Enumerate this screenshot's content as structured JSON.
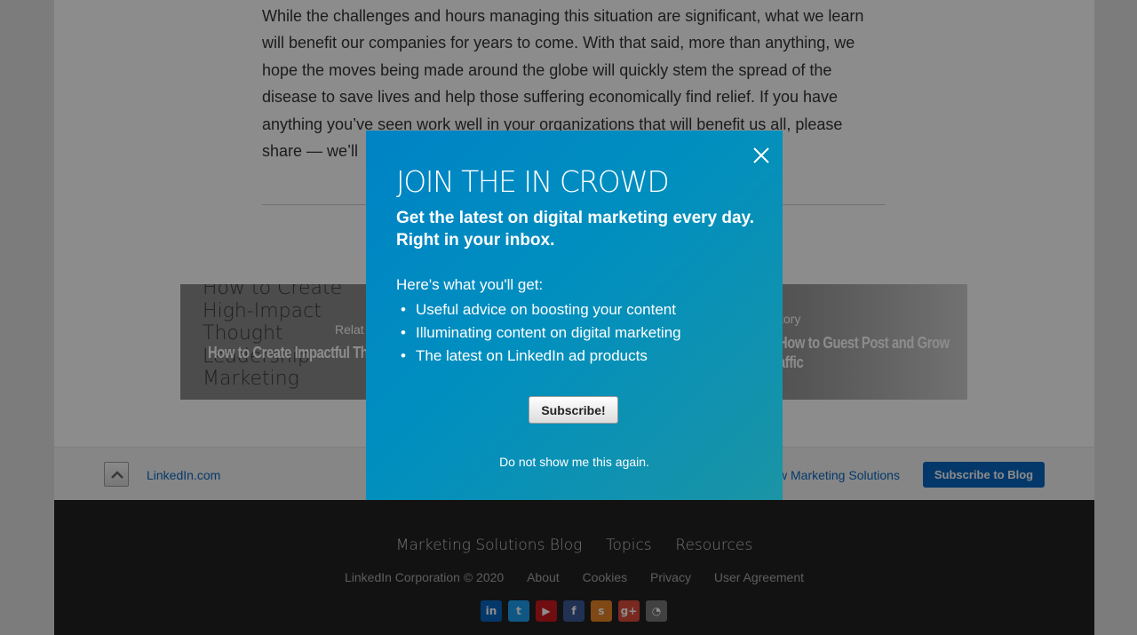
{
  "article": {
    "lines": [
      "While the challenges and hours managing this situation are significant, what we learn",
      "will benefit our companies for years to come. With that said, more than anything, we",
      "hope the moves being made around the globe will quickly stem the spread of the",
      "disease to save lives and help those suffering economically find relief. If you have",
      "anything you’ve seen work well in your organizations that will benefit us all, please",
      "share — we’ll"
    ]
  },
  "related": {
    "left": {
      "bg_title": "How to Create High-Impact Thought Leadership Marketing",
      "label": "Relat",
      "title": "How to Create Impactful Th"
    },
    "right": {
      "label": "story",
      "title_line1": "How to Guest Post and Grow",
      "title_line2": "affic"
    }
  },
  "footer_bar": {
    "linkedin_link": "LinkedIn.com",
    "marketing_link": "w Marketing Solutions",
    "subscribe_button": "Subscribe to Blog"
  },
  "site_footer": {
    "nav": [
      "Marketing Solutions Blog",
      "Topics",
      "Resources"
    ],
    "legal": [
      "LinkedIn Corporation © 2020",
      "About",
      "Cookies",
      "Privacy",
      "User Agreement"
    ],
    "social": [
      {
        "icon": "linkedin-icon",
        "glyph": "in",
        "color": "#0a66c2"
      },
      {
        "icon": "twitter-icon",
        "glyph": "t",
        "color": "#1da1f2"
      },
      {
        "icon": "youtube-icon",
        "glyph": "▶",
        "color": "#cc181e"
      },
      {
        "icon": "facebook-icon",
        "glyph": "f",
        "color": "#3b5998"
      },
      {
        "icon": "slideshare-icon",
        "glyph": "s",
        "color": "#e98325"
      },
      {
        "icon": "google-plus-icon",
        "glyph": "g+",
        "color": "#dd4b39"
      },
      {
        "icon": "rss-icon",
        "glyph": "◔",
        "color": "#777777"
      }
    ]
  },
  "modal": {
    "title": "JOIN THE IN CROWD",
    "subtitle": "Get the latest on digital marketing every day. Right in your inbox.",
    "intro": "Here's what you'll get:",
    "bullets": [
      "Useful advice on boosting your content",
      "Illuminating content on digital marketing",
      "The latest on LinkedIn ad products"
    ],
    "subscribe_button": "Subscribe!",
    "dismiss_link": "Do not show me this again."
  },
  "colors": {
    "modal_accent": "#008fbf",
    "link": "#0a66c2",
    "footer_bg": "#212121"
  }
}
